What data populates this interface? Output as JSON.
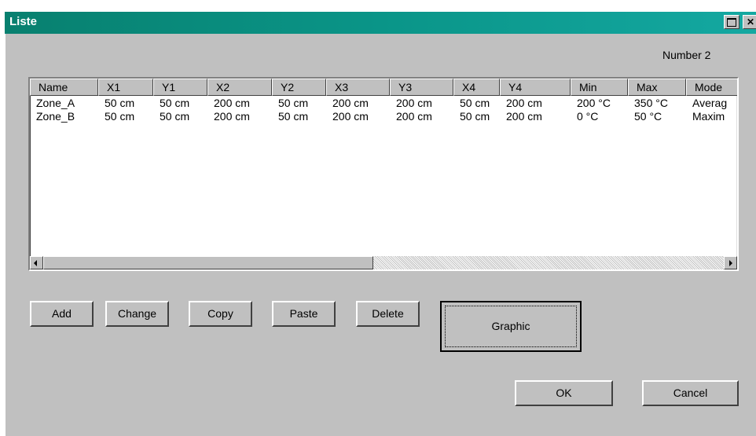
{
  "window": {
    "title": "Liste",
    "restore_icon": "restore-icon",
    "close_icon": "close-icon",
    "close_glyph": "✕"
  },
  "number_label": "Number 2",
  "list": {
    "columns": [
      "Name",
      "X1",
      "Y1",
      "X2",
      "Y2",
      "X3",
      "Y3",
      "X4",
      "Y4",
      "Min",
      "Max",
      "Mode"
    ],
    "rows": [
      [
        "Zone_A",
        "50 cm",
        "50 cm",
        "200 cm",
        "50 cm",
        "200 cm",
        "200 cm",
        "50 cm",
        "200 cm",
        "200 °C",
        "350 °C",
        "Averag"
      ],
      [
        "Zone_B",
        "50 cm",
        "50 cm",
        "200 cm",
        "50 cm",
        "200 cm",
        "200 cm",
        "50 cm",
        "200 cm",
        "0 °C",
        "50 °C",
        "Maxim"
      ]
    ]
  },
  "buttons": {
    "add": "Add",
    "change": "Change",
    "copy": "Copy",
    "paste": "Paste",
    "delete": "Delete",
    "graphic": "Graphic",
    "ok": "OK",
    "cancel": "Cancel"
  }
}
